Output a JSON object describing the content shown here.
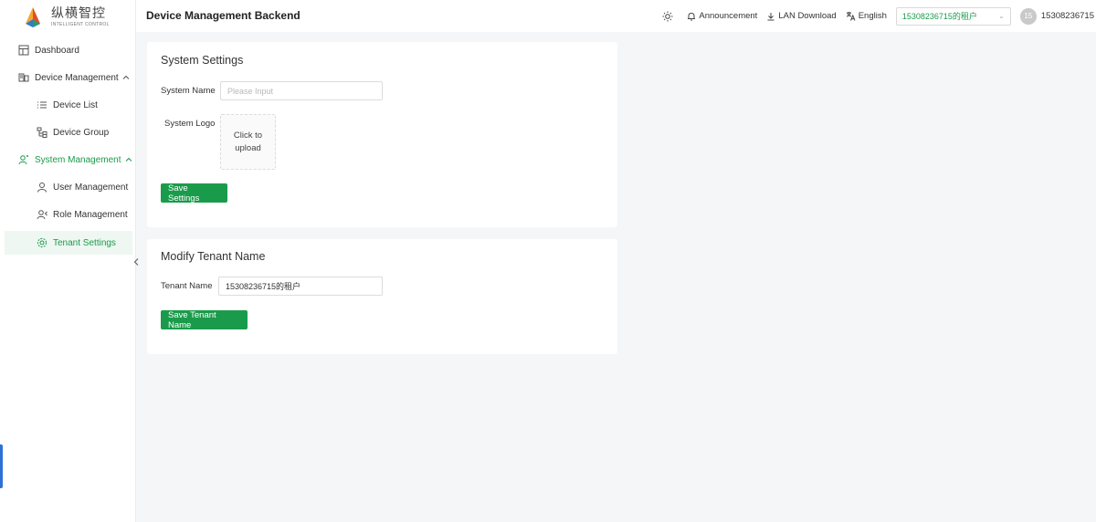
{
  "brand": {
    "name_cn": "纵横智控",
    "name_en": "INTELLIGENT CONTROL"
  },
  "header": {
    "title": "Device Management Backend",
    "announcement": "Announcement",
    "lan_download": "LAN Download",
    "language": "English",
    "tenant": "15308236715的租户",
    "avatar_text": "15",
    "user": "15308236715"
  },
  "sidebar": {
    "dashboard": "Dashboard",
    "device_management": "Device Management",
    "device_list": "Device List",
    "device_group": "Device Group",
    "system_management": "System Management",
    "user_management": "User Management",
    "role_management": "Role Management",
    "tenant_settings": "Tenant Settings",
    "accent": "#1a9b4b"
  },
  "system_settings": {
    "title": "System Settings",
    "name_label": "System Name",
    "name_placeholder": "Please Input",
    "logo_label": "System Logo",
    "upload_line1": "Click to",
    "upload_line2": "upload",
    "save_label": "Save Settings"
  },
  "tenant_form": {
    "title": "Modify Tenant Name",
    "name_label": "Tenant Name",
    "name_value": "15308236715的租户",
    "save_label": "Save Tenant Name"
  }
}
